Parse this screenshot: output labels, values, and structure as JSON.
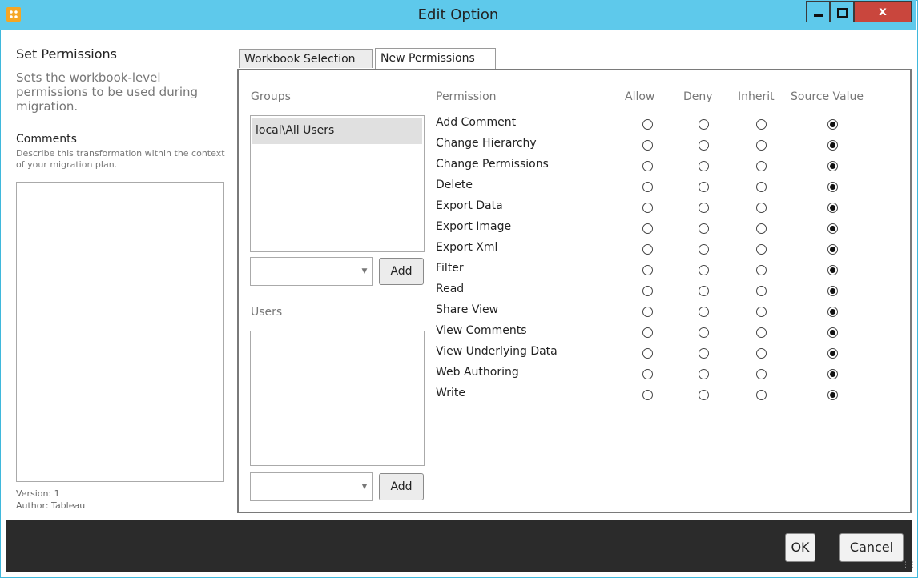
{
  "window": {
    "title": "Edit Option",
    "close_label": "x"
  },
  "left": {
    "heading": "Set Permissions",
    "description": "Sets the workbook-level permissions to be used during migration.",
    "comments_heading": "Comments",
    "comments_description": "Describe this transformation within the context of your migration plan.",
    "comments_value": "",
    "version": "Version: 1",
    "author": "Author:  Tableau"
  },
  "tabs": [
    {
      "label": "Workbook Selection",
      "active": false
    },
    {
      "label": "New Permissions",
      "active": true
    }
  ],
  "groups": {
    "label": "Groups",
    "items": [
      "local\\All Users"
    ],
    "combo_value": "",
    "add_label": "Add"
  },
  "users": {
    "label": "Users",
    "items": [],
    "combo_value": "",
    "add_label": "Add"
  },
  "permissions": {
    "headers": {
      "permission": "Permission",
      "allow": "Allow",
      "deny": "Deny",
      "inherit": "Inherit",
      "source": "Source Value"
    },
    "rows": [
      {
        "name": "Add Comment",
        "selected": "source"
      },
      {
        "name": "Change Hierarchy",
        "selected": "source"
      },
      {
        "name": "Change Permissions",
        "selected": "source"
      },
      {
        "name": "Delete",
        "selected": "source"
      },
      {
        "name": "Export Data",
        "selected": "source"
      },
      {
        "name": "Export Image",
        "selected": "source"
      },
      {
        "name": "Export Xml",
        "selected": "source"
      },
      {
        "name": "Filter",
        "selected": "source"
      },
      {
        "name": "Read",
        "selected": "source"
      },
      {
        "name": "Share View",
        "selected": "source"
      },
      {
        "name": "View Comments",
        "selected": "source"
      },
      {
        "name": "View Underlying Data",
        "selected": "source"
      },
      {
        "name": "Web Authoring",
        "selected": "source"
      },
      {
        "name": "Write",
        "selected": "source"
      }
    ]
  },
  "footer": {
    "ok_label": "OK",
    "cancel_label": "Cancel"
  },
  "colors": {
    "titlebar": "#5ec9eb",
    "close": "#c9463d",
    "footer": "#2b2b2b"
  }
}
